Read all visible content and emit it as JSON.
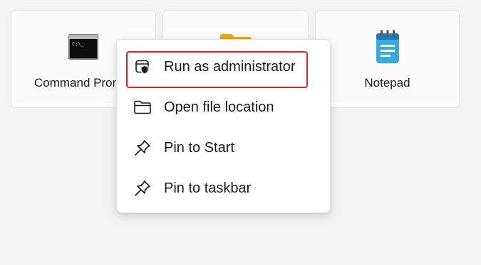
{
  "tiles": [
    {
      "label": "Command Prompt",
      "icon": "command-prompt-icon"
    },
    {
      "label": "",
      "icon": "folder-icon"
    },
    {
      "label": "Notepad",
      "icon": "notepad-icon"
    }
  ],
  "context_menu": {
    "items": [
      {
        "label": "Run as administrator",
        "icon": "shield-window-icon"
      },
      {
        "label": "Open file location",
        "icon": "folder-outline-icon"
      },
      {
        "label": "Pin to Start",
        "icon": "pin-icon"
      },
      {
        "label": "Pin to taskbar",
        "icon": "pin-icon"
      }
    ],
    "highlight_color": "#e5202d"
  },
  "colors": {
    "background": "#f3f3f3",
    "tile": "#fbfbfb",
    "menu": "#ffffff",
    "notepad_accent": "#39a8dc",
    "folder_accent": "#f3c43e"
  }
}
